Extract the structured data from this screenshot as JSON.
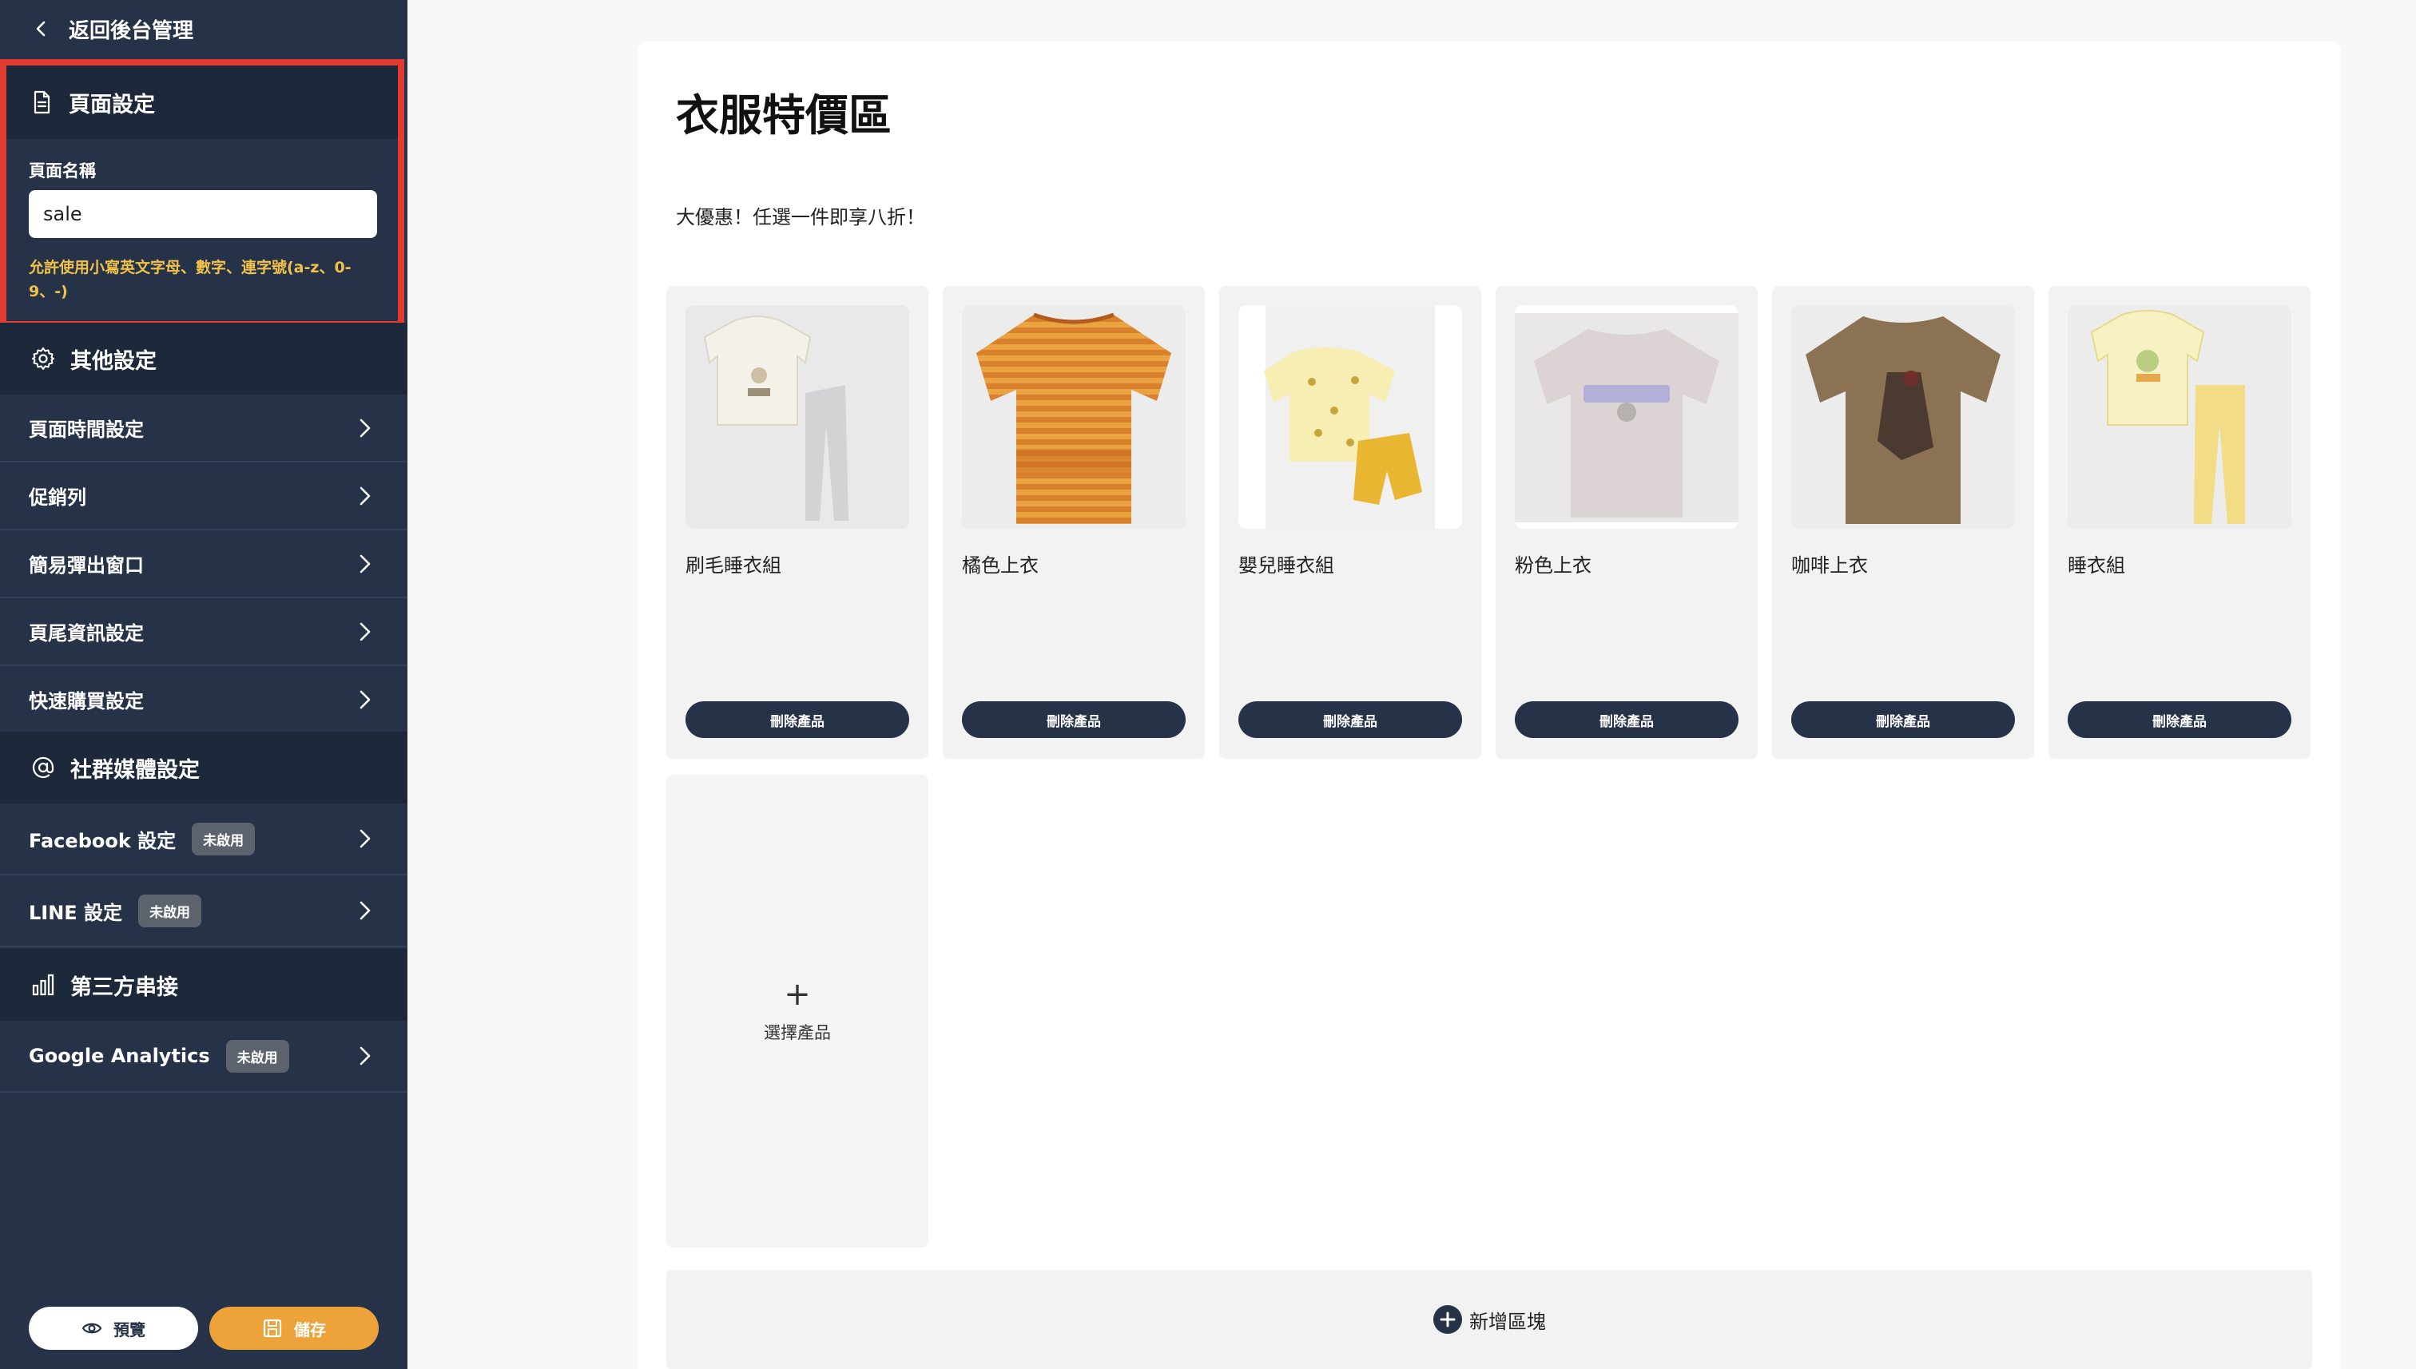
{
  "sidebar": {
    "back_label": "返回後台管理",
    "page_settings": {
      "title": "頁面設定",
      "field_label": "頁面名稱",
      "field_value": "sale",
      "hint": "允許使用小寫英文字母、數字、連字號(a-z、0-9、-)"
    },
    "other_settings": {
      "title": "其他設定",
      "items": [
        {
          "label": "頁面時間設定"
        },
        {
          "label": "促銷列"
        },
        {
          "label": "簡易彈出窗口"
        },
        {
          "label": "頁尾資訊設定"
        },
        {
          "label": "快速購買設定"
        }
      ]
    },
    "social": {
      "title": "社群媒體設定",
      "items": [
        {
          "label": "Facebook 設定",
          "badge": "未啟用"
        },
        {
          "label": "LINE 設定",
          "badge": "未啟用"
        }
      ]
    },
    "third_party": {
      "title": "第三方串接",
      "items": [
        {
          "label": "Google Analytics",
          "badge": "未啟用"
        }
      ]
    },
    "preview_label": "預覽",
    "save_label": "儲存"
  },
  "main": {
    "title": "衣服特價區",
    "description": "大優惠！任選一件即享八折！",
    "products": [
      {
        "name": "刷毛睡衣組",
        "delete_label": "刪除產品",
        "image": "fleece-pajama-set"
      },
      {
        "name": "橘色上衣",
        "delete_label": "刪除產品",
        "image": "orange-striped-tee"
      },
      {
        "name": "嬰兒睡衣組",
        "delete_label": "刪除產品",
        "image": "baby-pajama-set"
      },
      {
        "name": "粉色上衣",
        "delete_label": "刪除產品",
        "image": "pink-graphic-tee"
      },
      {
        "name": "咖啡上衣",
        "delete_label": "刪除產品",
        "image": "brown-graphic-tee"
      },
      {
        "name": "睡衣組",
        "delete_label": "刪除產品",
        "image": "yellow-pajama-set"
      }
    ],
    "select_product_label": "選擇產品",
    "add_block_label": "新增區塊"
  },
  "colors": {
    "sidebar_bg": "#263247",
    "section_header_bg": "#1d283a",
    "highlight_border": "#e23b2f",
    "hint_text": "#f1c24a",
    "save_button": "#eda33a",
    "delete_button": "#263247"
  }
}
